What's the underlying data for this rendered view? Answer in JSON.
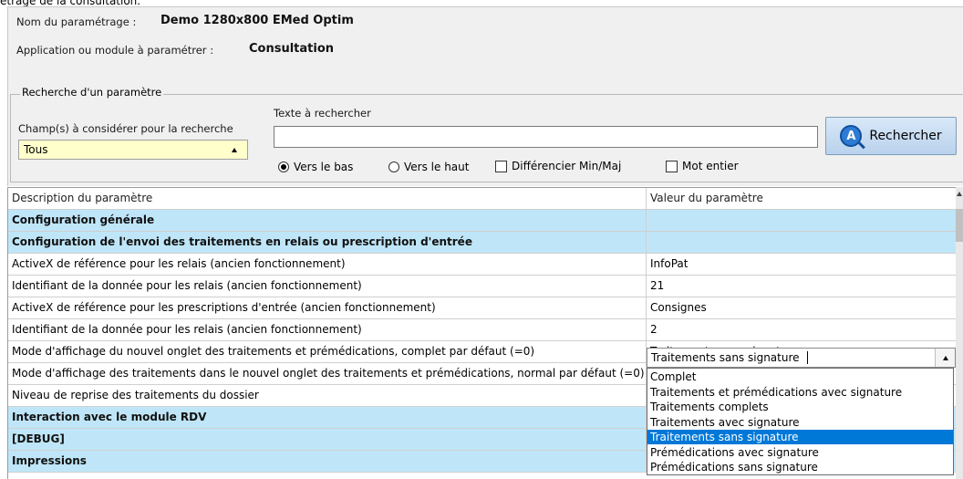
{
  "caption": "étrage de la consultation.",
  "info": {
    "name_label": "Nom du paramétrage :",
    "name_value": "Demo 1280x800 EMed Optim",
    "module_label": "Application ou module à paramétrer :",
    "module_value": "Consultation"
  },
  "search": {
    "legend": "Recherche d'un paramètre",
    "fields_label": "Champ(s) à considérer pour la recherche",
    "fields_value": "Tous",
    "text_label": "Texte à rechercher",
    "text_value": "",
    "button_label": "Rechercher",
    "button_icon": "search-icon",
    "direction_down": "Vers le bas",
    "direction_down_selected": true,
    "direction_up": "Vers le haut",
    "case_sensitive": "Différencier Min/Maj",
    "case_sensitive_checked": false,
    "whole_word": "Mot entier",
    "whole_word_checked": false
  },
  "grid": {
    "col_description": "Description du paramètre",
    "col_value": "Valeur du paramètre",
    "rows": [
      {
        "desc": "Configuration générale",
        "value": "",
        "section": true
      },
      {
        "desc": "Configuration de l'envoi des traitements en relais ou prescription d'entrée",
        "value": "",
        "section": true
      },
      {
        "desc": "ActiveX de référence pour les relais (ancien fonctionnement)",
        "value": "InfoPat",
        "section": false
      },
      {
        "desc": "Identifiant de la donnée pour les relais (ancien fonctionnement)",
        "value": "21",
        "section": false
      },
      {
        "desc": "ActiveX de référence pour les prescriptions d'entrée (ancien fonctionnement)",
        "value": "Consignes",
        "section": false
      },
      {
        "desc": "Identifiant de la donnée pour les relais (ancien fonctionnement)",
        "value": "2",
        "section": false
      },
      {
        "desc": "Mode d'affichage du nouvel onglet des traitements et prémédications, complet par défaut (=0)",
        "value": "Traitements sans signature",
        "section": false
      },
      {
        "desc": "Mode d'affichage des traitements dans le nouvel onglet des traitements et prémédications, normal par défaut (=0)",
        "value": "",
        "section": false
      },
      {
        "desc": "Niveau de reprise des traitements du dossier",
        "value": "",
        "section": false
      },
      {
        "desc": "Interaction avec le module RDV",
        "value": "",
        "section": true
      },
      {
        "desc": "[DEBUG]",
        "value": "",
        "section": true
      },
      {
        "desc": "Impressions",
        "value": "",
        "section": true
      }
    ]
  },
  "dropdown": {
    "current": "Traitements sans signature",
    "options": [
      "Complet",
      "Traitements et prémédications avec signature",
      "Traitements complets",
      "Traitements avec signature",
      "Traitements sans signature",
      "Prémédications avec signature",
      "Prémédications sans signature"
    ],
    "selected_index": 4
  },
  "colors": {
    "section_row": "#bfe6f8",
    "combo_bg": "#ffffcc",
    "selection": "#0078d7",
    "panel_bg": "#f0f0f0"
  }
}
